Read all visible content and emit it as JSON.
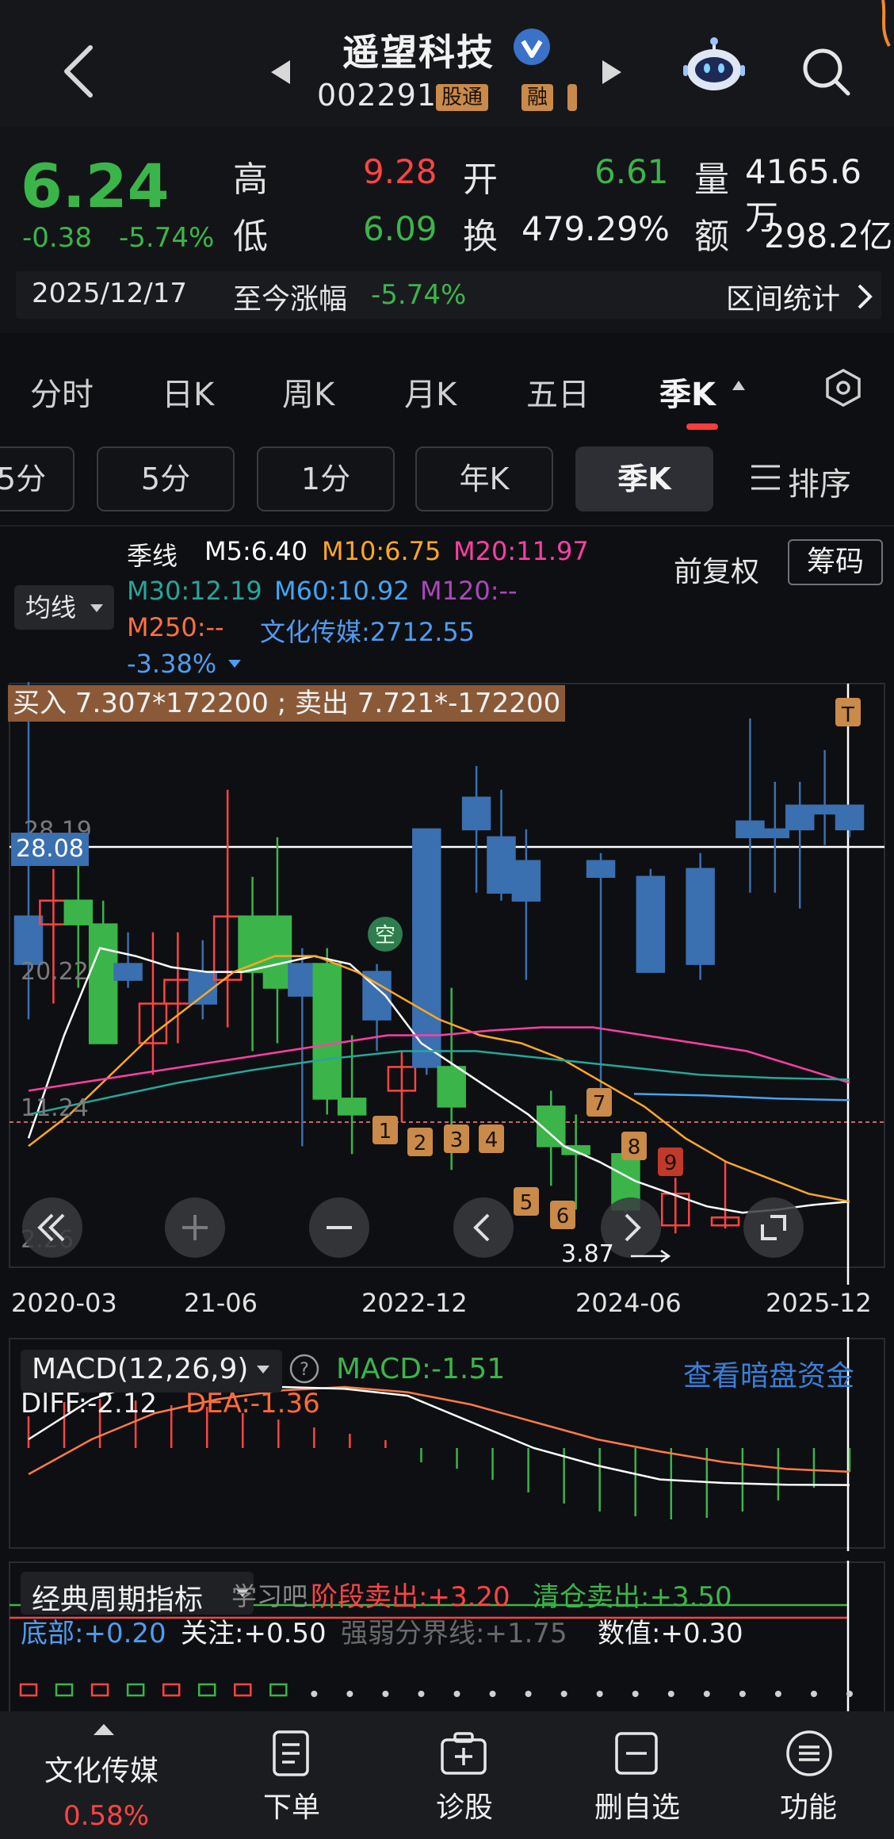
{
  "header": {
    "stock_name": "遥望科技",
    "stock_code": "002291",
    "badge_connect": "股通",
    "badge_margin": "融"
  },
  "quote": {
    "price": "6.24",
    "change": "-0.38",
    "change_pct": "-5.74%",
    "high_label": "高",
    "high": "9.28",
    "open_label": "开",
    "open": "6.61",
    "volume_label": "量",
    "volume": "4165.6万",
    "low_label": "低",
    "low": "6.09",
    "turnover_label": "换",
    "turnover": "479.29%",
    "amount_label": "额",
    "amount": "298.2亿",
    "date": "2025/12/17",
    "since_label": "至今涨幅",
    "since_value": "-5.74%",
    "range_stats": "区间统计"
  },
  "period_tabs": [
    "分时",
    "日K",
    "周K",
    "月K",
    "五日",
    "季K"
  ],
  "active_tab": "季K",
  "sub_periods": [
    "5分",
    "5分",
    "1分",
    "年K",
    "季K"
  ],
  "sort_label": "排序",
  "chart_header": {
    "avg_line": "均线",
    "line_type": "季线",
    "m5": "M5:6.40",
    "m10": "M10:6.75",
    "m20": "M20:11.97",
    "m30": "M30:12.19",
    "m60": "M60:10.92",
    "m120": "M120:--",
    "m250": "M250:--",
    "sector": "文化传媒:2712.55",
    "sector_pct": "-3.38%",
    "front_adjust": "前复权",
    "chips": "筹码"
  },
  "trade_banner": "买入 7.307*172200 ; 卖出 7.721*-172200",
  "crosshair_price": "28.08",
  "axis_prices": [
    "28.19",
    "20.22",
    "11.24",
    "2.26"
  ],
  "low_marker": "3.87",
  "short_marker": "空",
  "marker_labels": [
    "1",
    "2",
    "3",
    "4",
    "5",
    "6",
    "7",
    "8",
    "9"
  ],
  "top_marker": "T",
  "date_ticks": [
    "2020-03",
    "21-06",
    "2022-12",
    "2024-06",
    "2025-12"
  ],
  "macd": {
    "title": "MACD(12,26,9)",
    "macd_value": "MACD:-1.51",
    "dark_fund": "查看暗盘资金",
    "diff": "DIFF:-2.12",
    "dea": "DEA:-1.36"
  },
  "cycle": {
    "title": "经典周期指标",
    "learn": "学习吧",
    "stage_sell": "阶段卖出:+3.20",
    "clear_sell": "清仓卖出:+3.50",
    "bottom": "底部:+0.20",
    "attention": "关注:+0.50",
    "strength": "强弱分界线:+1.75",
    "value": "数值:+0.30"
  },
  "bottom_bar": {
    "sector_name": "文化传媒",
    "sector_pct": "0.58%",
    "order": "下单",
    "diagnose": "诊股",
    "remove_watch": "删自选",
    "functions": "功能"
  },
  "colors": {
    "up": "#ff4444",
    "down": "#3bb54a",
    "blue_candle": "#3a6fb0",
    "m5": "#ffffff",
    "m10": "#ffa726",
    "m20": "#ff3fa4",
    "m30": "#26a69a",
    "m60": "#42a5f5",
    "m120": "#ab47bc",
    "m250": "#ff7043"
  },
  "chart_data": {
    "type": "candlestick",
    "period": "quarterly",
    "x_labels": [
      "2020-03",
      "21-06",
      "2022-12",
      "2024-06",
      "2025-12"
    ],
    "y_ticks": [
      28.19,
      20.22,
      11.24,
      2.26
    ],
    "candles": [
      {
        "o": 19.5,
        "c": 22.5,
        "h": 50.0,
        "l": 16.0,
        "color": "blue"
      },
      {
        "o": 22.0,
        "c": 23.5,
        "h": 25.5,
        "l": 17.0,
        "color": "red"
      },
      {
        "o": 22.0,
        "c": 23.5,
        "h": 27.0,
        "l": 18.0,
        "color": "green"
      },
      {
        "o": 14.5,
        "c": 22.0,
        "h": 23.5,
        "l": 14.5,
        "color": "green"
      },
      {
        "o": 19.5,
        "c": 18.5,
        "h": 21.5,
        "l": 18.0,
        "color": "blue"
      },
      {
        "o": 14.5,
        "c": 17.0,
        "h": 21.5,
        "l": 12.5,
        "color": "red"
      },
      {
        "o": 17.0,
        "c": 18.5,
        "h": 21.5,
        "l": 14.5,
        "color": "red"
      },
      {
        "o": 17.0,
        "c": 19.0,
        "h": 21.0,
        "l": 16.0,
        "color": "blue"
      },
      {
        "o": 18.5,
        "c": 22.5,
        "h": 30.5,
        "l": 15.5,
        "color": "red"
      },
      {
        "o": 19.0,
        "c": 22.5,
        "h": 25.0,
        "l": 14.0,
        "color": "green"
      },
      {
        "o": 18.0,
        "c": 22.5,
        "h": 27.5,
        "l": 14.5,
        "color": "green"
      },
      {
        "o": 17.5,
        "c": 19.5,
        "h": 20.5,
        "l": 8.0,
        "color": "blue"
      },
      {
        "o": 11.0,
        "c": 19.5,
        "h": 20.5,
        "l": 10.0,
        "color": "green"
      },
      {
        "o": 10.0,
        "c": 11.0,
        "h": 15.0,
        "l": 7.5,
        "color": "green"
      },
      {
        "o": 16.0,
        "c": 19.0,
        "h": 19.5,
        "l": 14.0,
        "color": "blue"
      },
      {
        "o": 11.5,
        "c": 13.0,
        "h": 14.0,
        "l": 9.5,
        "color": "red"
      },
      {
        "o": 13.0,
        "c": 28.0,
        "h": 28.0,
        "l": 12.5,
        "color": "blue"
      },
      {
        "o": 10.5,
        "c": 13.0,
        "h": 18.0,
        "l": 6.5,
        "color": "green"
      },
      {
        "o": 30.0,
        "c": 28.0,
        "h": 32.0,
        "l": 24.0,
        "color": "blue"
      },
      {
        "o": 27.5,
        "c": 24.0,
        "h": 30.5,
        "l": 23.5,
        "color": "blue"
      },
      {
        "o": 26.0,
        "c": 23.5,
        "h": 28.0,
        "l": 18.5,
        "color": "blue"
      },
      {
        "o": 8.0,
        "c": 10.5,
        "h": 11.5,
        "l": 5.5,
        "color": "green"
      },
      {
        "o": 7.5,
        "c": 8.0,
        "h": 10.0,
        "l": 4.0,
        "color": "green"
      },
      {
        "o": 26.0,
        "c": 25.0,
        "h": 26.5,
        "l": 10.0,
        "color": "blue"
      },
      {
        "o": 4.0,
        "c": 7.5,
        "h": 8.5,
        "l": 3.8,
        "color": "green"
      },
      {
        "o": 25.0,
        "c": 19.0,
        "h": 25.5,
        "l": 19.0,
        "color": "blue"
      },
      {
        "o": 3.0,
        "c": 5.0,
        "h": 6.0,
        "l": 2.5,
        "color": "red"
      },
      {
        "o": 25.5,
        "c": 19.5,
        "h": 26.5,
        "l": 18.5,
        "color": "blue"
      },
      {
        "o": 3.0,
        "c": 3.5,
        "h": 7.0,
        "l": 2.8,
        "color": "red"
      },
      {
        "o": 28.5,
        "c": 27.5,
        "h": 35.0,
        "l": 24.0,
        "color": "blue"
      },
      {
        "o": 28.0,
        "c": 27.5,
        "h": 31.0,
        "l": 24.0,
        "color": "blue"
      },
      {
        "o": 28.0,
        "c": 29.5,
        "h": 31.0,
        "l": 23.0,
        "color": "blue"
      },
      {
        "o": 29.5,
        "c": 29.0,
        "h": 33.0,
        "l": 27.0,
        "color": "blue"
      },
      {
        "o": 29.5,
        "c": 28.0,
        "h": 29.5,
        "l": 27.5,
        "color": "blue"
      }
    ],
    "ma_series": [
      {
        "name": "M5",
        "values": [
          8.5,
          15.0,
          20.5,
          20.0,
          19.3,
          19.0,
          19.0,
          19.5,
          20.0,
          19.5,
          17.5,
          14.5,
          13.0,
          11.5,
          10.0,
          8.0,
          7.0,
          5.8,
          5.0,
          4.2,
          3.8,
          4.0,
          4.3,
          4.5
        ]
      },
      {
        "name": "M10",
        "values": [
          8.0,
          10.0,
          12.5,
          15.0,
          17.0,
          19.0,
          20.0,
          20.0,
          19.0,
          17.5,
          16.0,
          15.0,
          14.5,
          13.5,
          12.0,
          10.5,
          8.5,
          7.0,
          6.0,
          5.0,
          4.5
        ]
      },
      {
        "name": "M20",
        "values": [
          11.5,
          12.0,
          12.5,
          13.0,
          13.5,
          14.0,
          14.5,
          15.0,
          15.0,
          15.3,
          15.5,
          15.5,
          15.0,
          14.5,
          14.0,
          13.0,
          12.0
        ]
      },
      {
        "name": "M30",
        "values": [
          10.0,
          11.0,
          12.0,
          12.8,
          13.5,
          14.0,
          14.0,
          13.5,
          13.0,
          12.5,
          12.3,
          12.2
        ]
      },
      {
        "name": "M60",
        "values": [
          11.3,
          11.2,
          11.0,
          10.9
        ]
      }
    ],
    "macd": {
      "diff": [
        0.5,
        2.8,
        4.0,
        3.8,
        3.5,
        3.4,
        3.0,
        1.5,
        0.0,
        -1.0,
        -1.8,
        -2.0,
        -2.1,
        -2.12
      ],
      "dea": [
        -1.5,
        0.5,
        2.0,
        2.8,
        3.3,
        3.5,
        3.2,
        2.5,
        1.5,
        0.5,
        -0.2,
        -0.8,
        -1.2,
        -1.36
      ]
    }
  }
}
